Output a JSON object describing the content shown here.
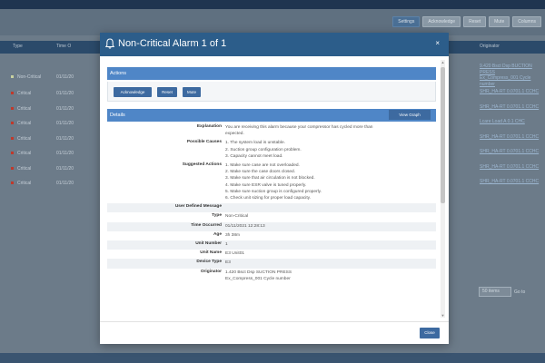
{
  "toolbar": {
    "buttons": [
      "Settings",
      "Acknowledge",
      "Reset",
      "Mute",
      "Columns"
    ]
  },
  "table": {
    "columns": [
      "Type",
      "Time O",
      "Originator"
    ],
    "rows": [
      {
        "type": "Non-Critical",
        "time": "01/11/20",
        "originator": [
          "9.420 Bsct Dsp BUCTION",
          "PRESS",
          "Ex_Compress_001 Cycle",
          "number"
        ],
        "color": "#c9d2a0"
      },
      {
        "type": "Critical",
        "time": "01/11/20",
        "originator": [
          "SHR_HA-RT 0.0701.1 CCHC"
        ],
        "color": "#c0392b"
      },
      {
        "type": "Critical",
        "time": "01/11/20",
        "originator": [
          "SHR_HA-RT 0.0701.1 CCHC"
        ],
        "color": "#c0392b"
      },
      {
        "type": "Critical",
        "time": "01/11/20",
        "originator": [
          "Lcare Load A 0.1 CHC"
        ],
        "color": "#c0392b"
      },
      {
        "type": "Critical",
        "time": "01/11/20",
        "originator": [
          "SHR_HA-RT 0.0701.1 CCHC"
        ],
        "color": "#c0392b"
      },
      {
        "type": "Critical",
        "time": "01/11/20",
        "originator": [
          "SHR_HA-RT 0.0701.1 CCHC"
        ],
        "color": "#c0392b"
      },
      {
        "type": "Critical",
        "time": "01/11/20",
        "originator": [
          "SHR_HA-RT 0.0701.1 CCHC"
        ],
        "color": "#c0392b"
      },
      {
        "type": "Critical",
        "time": "01/11/20",
        "originator": [
          "SHR_HA-RT 0.0701.1 CCHC"
        ],
        "color": "#c0392b"
      }
    ],
    "paging": {
      "page_size": "50 items",
      "go": "Go to"
    }
  },
  "modal": {
    "title": "Non-Critical Alarm 1 of 1",
    "close_icon": "×",
    "actions_heading": "Actions",
    "action_buttons": [
      "Acknowledge",
      "Reset",
      "Mute"
    ],
    "details_heading": "Details",
    "view_graph": "View Graph",
    "details": [
      {
        "label": "Explanation",
        "lines": [
          "You are receiving this alarm because your compressor has cycled more than",
          "expected."
        ]
      },
      {
        "label": "Possible Causes",
        "lines": [
          "1. The system load is unstable.",
          "2. Suction group configuration problem.",
          "3. Capacity cannot meet load."
        ]
      },
      {
        "label": "Suggested Actions",
        "lines": [
          "1. Make sure case are not overloaded.",
          "2. Make sure the case doors closed.",
          "3. Make sure that air circulation is not blocked.",
          "4. Make sure ESR valve is tuned properly.",
          "5. Make sure suction group is configured properly.",
          "6. Check unit sizing for proper load capacity."
        ]
      },
      {
        "label": "User Defined Message",
        "lines": [
          ""
        ]
      },
      {
        "label": "Type",
        "lines": [
          "Non-Critical"
        ]
      },
      {
        "label": "Time Occurred",
        "lines": [
          "01/11/2021 12:28:13"
        ]
      },
      {
        "label": "Age",
        "lines": [
          "3h 38m"
        ]
      },
      {
        "label": "Unit Number",
        "lines": [
          "1"
        ]
      },
      {
        "label": "Unit Name",
        "lines": [
          "E3 Unit01"
        ]
      },
      {
        "label": "Device Type",
        "lines": [
          "E3"
        ]
      },
      {
        "label": "Originator",
        "lines": [
          "1.420 Bsct Dsp SUCTION PRESS",
          "Ex_Compress_001 Cycle number"
        ]
      }
    ],
    "close_button": "Close"
  },
  "colors": {
    "header": "#2c5d8a",
    "section": "#4f86c7",
    "button": "#3d6aa0",
    "critical": "#c0392b"
  },
  "icons": {
    "title_icon": "bell-icon"
  }
}
